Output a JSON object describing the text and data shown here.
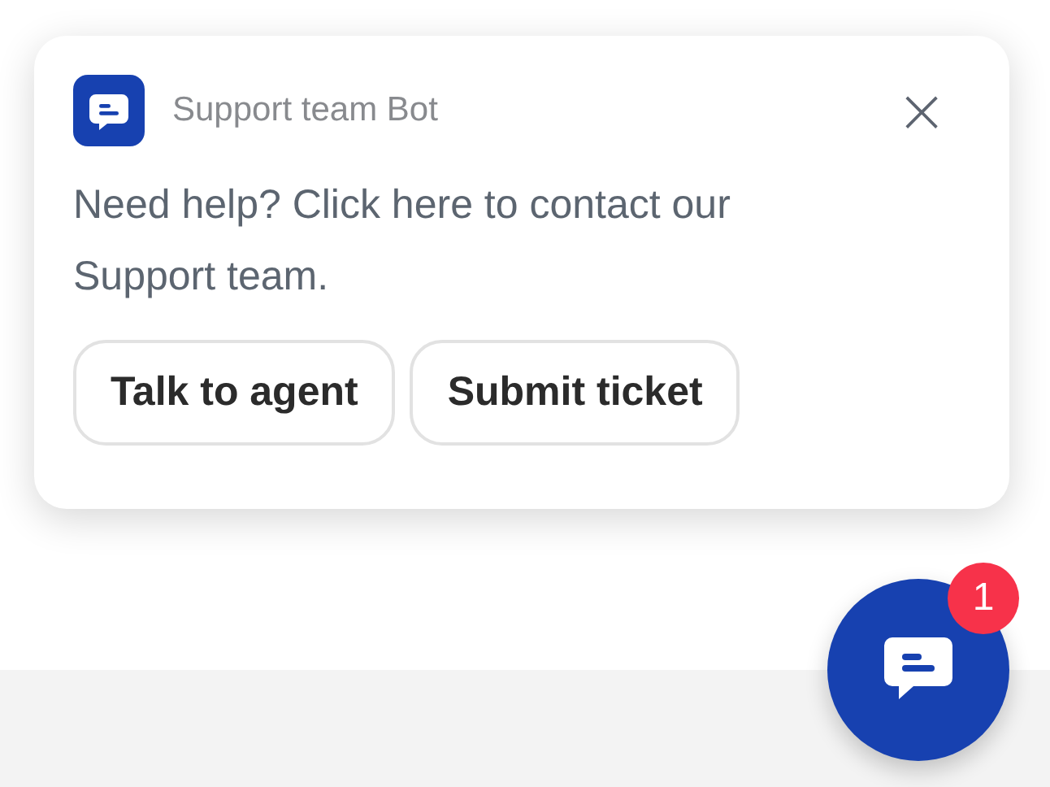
{
  "popup": {
    "sender": "Support team Bot",
    "message": "Need help? Click here to contact our Support team.",
    "close": "×",
    "buttons": [
      "Talk to agent",
      "Submit ticket"
    ]
  },
  "launcher": {
    "badge": "1"
  }
}
